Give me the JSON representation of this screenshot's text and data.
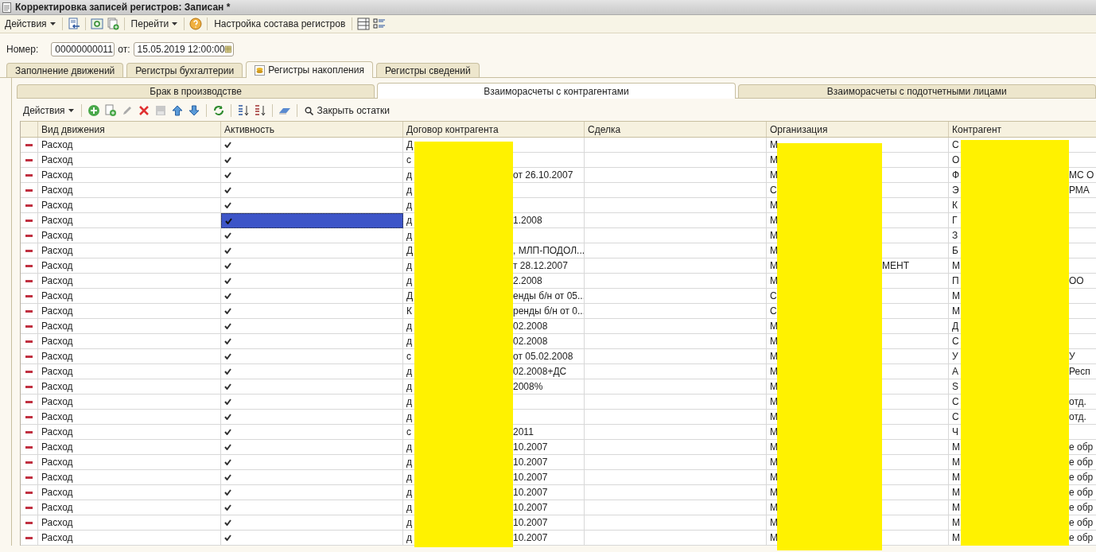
{
  "window": {
    "title": "Корректировка записей регистров: Записан *"
  },
  "toolbar": {
    "actions": "Действия",
    "goto": "Перейти",
    "settings": "Настройка состава регистров"
  },
  "header_fields": {
    "number_label": "Номер:",
    "number": "00000000011",
    "date_label": "от:",
    "date": "15.05.2019 12:00:00"
  },
  "tabs": [
    {
      "label": "Заполнение движений",
      "selected": false
    },
    {
      "label": "Регистры бухгалтерии",
      "selected": false
    },
    {
      "label": "Регистры накопления",
      "selected": true
    },
    {
      "label": "Регистры сведений",
      "selected": false
    }
  ],
  "subtabs": [
    {
      "label": "Брак в производстве",
      "selected": false
    },
    {
      "label": "Взаиморасчеты с контрагентами",
      "selected": true
    },
    {
      "label": "Взаиморасчеты с подотчетными лицами",
      "selected": false
    }
  ],
  "table_toolbar": {
    "actions": "Действия",
    "close_balances": "Закрыть остатки"
  },
  "table": {
    "columns": [
      "Вид движения",
      "Активность",
      "Договор контрагента",
      "Сделка",
      "Организация",
      "Контрагент"
    ],
    "rows": [
      {
        "movement": "Расход",
        "active": true,
        "selected": false,
        "contract": {
          "start": "Д"
        },
        "org": {
          "start": "М"
        },
        "counterparty": {
          "start": "С"
        }
      },
      {
        "movement": "Расход",
        "active": true,
        "selected": false,
        "contract": {
          "start": "с"
        },
        "org": {
          "start": "М"
        },
        "counterparty": {
          "start": "О"
        }
      },
      {
        "movement": "Расход",
        "active": true,
        "selected": false,
        "contract": {
          "start": "д",
          "end": "от 26.10.2007"
        },
        "org": {
          "start": "М"
        },
        "counterparty": {
          "start": "Ф",
          "end": "МС О"
        }
      },
      {
        "movement": "Расход",
        "active": true,
        "selected": false,
        "contract": {
          "start": "д"
        },
        "org": {
          "start": "С"
        },
        "counterparty": {
          "start": "Э",
          "end": "РМА"
        }
      },
      {
        "movement": "Расход",
        "active": true,
        "selected": false,
        "contract": {
          "start": "д"
        },
        "org": {
          "start": "М"
        },
        "counterparty": {
          "start": "К"
        }
      },
      {
        "movement": "Расход",
        "active": true,
        "selected": true,
        "contract": {
          "start": "д",
          "end": "1.2008"
        },
        "org": {
          "start": "М"
        },
        "counterparty": {
          "start": "Г"
        }
      },
      {
        "movement": "Расход",
        "active": true,
        "selected": false,
        "contract": {
          "start": "д"
        },
        "org": {
          "start": "М"
        },
        "counterparty": {
          "start": "З"
        }
      },
      {
        "movement": "Расход",
        "active": true,
        "selected": false,
        "contract": {
          "start": "Д",
          "end": ", МЛП-ПОДОЛ..."
        },
        "org": {
          "start": "М"
        },
        "counterparty": {
          "start": "Б"
        }
      },
      {
        "movement": "Расход",
        "active": true,
        "selected": false,
        "contract": {
          "start": "д",
          "end": "т 28.12.2007"
        },
        "org": {
          "start": "М",
          "end": "МЕНТ"
        },
        "counterparty": {
          "start": "М"
        }
      },
      {
        "movement": "Расход",
        "active": true,
        "selected": false,
        "contract": {
          "start": "д",
          "end": "2.2008"
        },
        "org": {
          "start": "М"
        },
        "counterparty": {
          "start": "П",
          "end": "ОО"
        }
      },
      {
        "movement": "Расход",
        "active": true,
        "selected": false,
        "contract": {
          "start": "Д",
          "end": "енды б/н от 05..."
        },
        "org": {
          "start": "С"
        },
        "counterparty": {
          "start": "М"
        }
      },
      {
        "movement": "Расход",
        "active": true,
        "selected": false,
        "contract": {
          "start": "К",
          "end": "ренды б/н от 0..."
        },
        "org": {
          "start": "С"
        },
        "counterparty": {
          "start": "М"
        }
      },
      {
        "movement": "Расход",
        "active": true,
        "selected": false,
        "contract": {
          "start": "д",
          "end": "02.2008"
        },
        "org": {
          "start": "М"
        },
        "counterparty": {
          "start": "Д"
        }
      },
      {
        "movement": "Расход",
        "active": true,
        "selected": false,
        "contract": {
          "start": "д",
          "end": "02.2008"
        },
        "org": {
          "start": "М"
        },
        "counterparty": {
          "start": "С"
        }
      },
      {
        "movement": "Расход",
        "active": true,
        "selected": false,
        "contract": {
          "start": "с",
          "end": "от 05.02.2008"
        },
        "org": {
          "start": "М"
        },
        "counterparty": {
          "start": "У",
          "end": "У"
        }
      },
      {
        "movement": "Расход",
        "active": true,
        "selected": false,
        "contract": {
          "start": "д",
          "end": "02.2008+ДС"
        },
        "org": {
          "start": "М"
        },
        "counterparty": {
          "start": "А",
          "end": "Респ"
        }
      },
      {
        "movement": "Расход",
        "active": true,
        "selected": false,
        "contract": {
          "start": "д",
          "end": "2008%"
        },
        "org": {
          "start": "М"
        },
        "counterparty": {
          "start": "S"
        }
      },
      {
        "movement": "Расход",
        "active": true,
        "selected": false,
        "contract": {
          "start": "д"
        },
        "org": {
          "start": "М"
        },
        "counterparty": {
          "start": "С",
          "end": "отд."
        }
      },
      {
        "movement": "Расход",
        "active": true,
        "selected": false,
        "contract": {
          "start": "д"
        },
        "org": {
          "start": "М"
        },
        "counterparty": {
          "start": "С",
          "end": "отд."
        }
      },
      {
        "movement": "Расход",
        "active": true,
        "selected": false,
        "contract": {
          "start": "с",
          "end": "2011"
        },
        "org": {
          "start": "М"
        },
        "counterparty": {
          "start": "Ч"
        }
      },
      {
        "movement": "Расход",
        "active": true,
        "selected": false,
        "contract": {
          "start": "д",
          "end": "10.2007"
        },
        "org": {
          "start": "М"
        },
        "counterparty": {
          "start": "М",
          "end": "е обр"
        }
      },
      {
        "movement": "Расход",
        "active": true,
        "selected": false,
        "contract": {
          "start": "д",
          "end": "10.2007"
        },
        "org": {
          "start": "М"
        },
        "counterparty": {
          "start": "М",
          "end": "е обр"
        }
      },
      {
        "movement": "Расход",
        "active": true,
        "selected": false,
        "contract": {
          "start": "д",
          "end": "10.2007"
        },
        "org": {
          "start": "М"
        },
        "counterparty": {
          "start": "М",
          "end": "е обр"
        }
      },
      {
        "movement": "Расход",
        "active": true,
        "selected": false,
        "contract": {
          "start": "д",
          "end": "10.2007"
        },
        "org": {
          "start": "М"
        },
        "counterparty": {
          "start": "М",
          "end": "е обр"
        }
      },
      {
        "movement": "Расход",
        "active": true,
        "selected": false,
        "contract": {
          "start": "д",
          "end": "10.2007"
        },
        "org": {
          "start": "М"
        },
        "counterparty": {
          "start": "М",
          "end": "е обр"
        }
      },
      {
        "movement": "Расход",
        "active": true,
        "selected": false,
        "contract": {
          "start": "д",
          "end": "10.2007"
        },
        "org": {
          "start": "М"
        },
        "counterparty": {
          "start": "М",
          "end": "е обр"
        }
      },
      {
        "movement": "Расход",
        "active": true,
        "selected": false,
        "contract": {
          "start": "д",
          "end": "10.2007"
        },
        "org": {
          "start": "М"
        },
        "counterparty": {
          "start": "М",
          "end": "е обр"
        }
      }
    ]
  }
}
